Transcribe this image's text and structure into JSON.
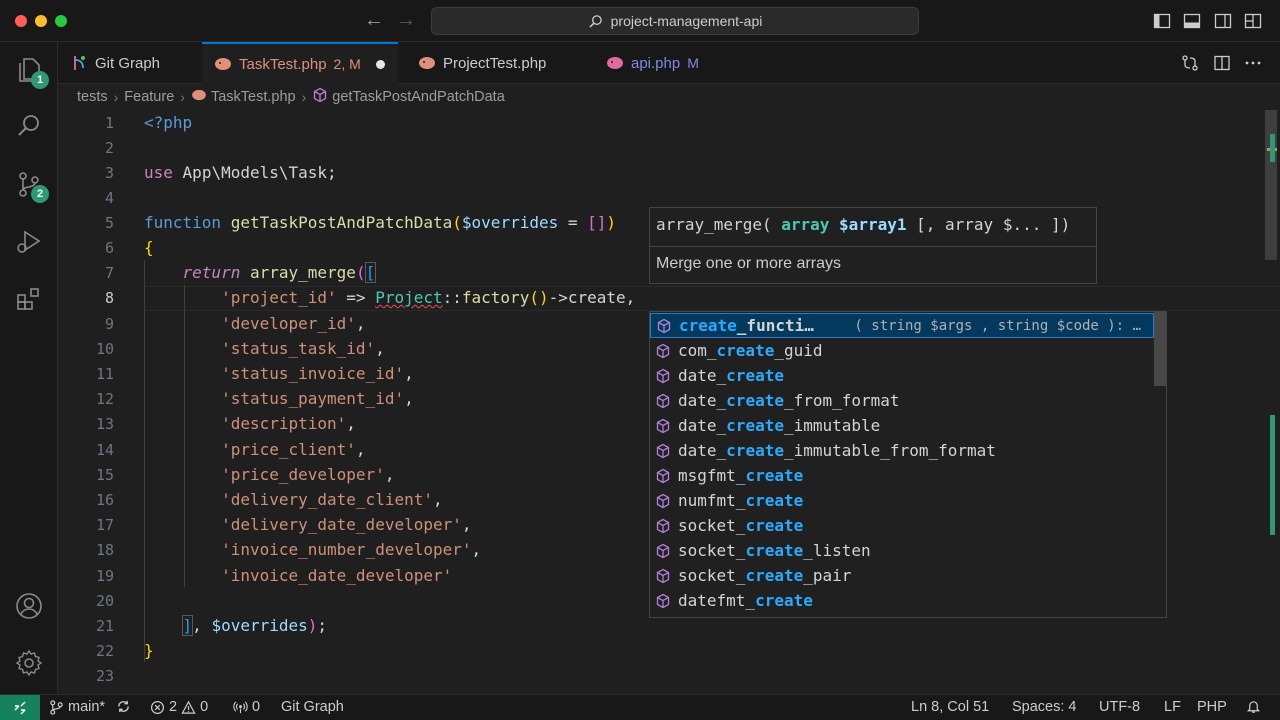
{
  "titlebar": {
    "title": "project-management-api",
    "nav_back": "←",
    "nav_forward": "→"
  },
  "activity": {
    "explorer_badge": "1",
    "scm_badge": "2"
  },
  "tabs": [
    {
      "label": "Git Graph",
      "status": ""
    },
    {
      "label": "TaskTest.php",
      "status": "2, M",
      "active": true,
      "dirty": true
    },
    {
      "label": "ProjectTest.php",
      "status": ""
    },
    {
      "label": "api.php",
      "status": "M"
    }
  ],
  "breadcrumb": {
    "items": [
      "tests",
      "Feature",
      "TaskTest.php",
      "getTaskPostAndPatchData"
    ],
    "separator": "›"
  },
  "editor": {
    "current_line": 8,
    "line_numbers": [
      "1",
      "2",
      "3",
      "4",
      "5",
      "6",
      "7",
      "8",
      "9",
      "10",
      "11",
      "12",
      "13",
      "14",
      "15",
      "16",
      "17",
      "18",
      "19",
      "20",
      "21",
      "22",
      "23"
    ],
    "code": {
      "l1": "<?php",
      "l3_use": "use",
      "l3_ns": "App\\Models\\Task",
      "l3_semi": ";",
      "l5_kw": "function",
      "l5_fn": "getTaskPostAndPatchData",
      "l5_open": "(",
      "l5_var": "$overrides",
      "l5_eq": " = ",
      "l5_arr": "[]",
      "l5_close": ")",
      "l6": "{",
      "l7_ret": "return",
      "l7_fn": "array_merge",
      "l7_open": "(",
      "l7_br": "[",
      "l8_str": "'project_id'",
      "l8_arrow": " => ",
      "l8_cls": "Project",
      "l8_sep": "::",
      "l8_fn": "factory",
      "l8_paren": "()",
      "l8_arrow2": "->",
      "l8_create": "create",
      "l8_comma": ",",
      "l9": "'developer_id'",
      "l10": "'status_task_id'",
      "l11": "'status_invoice_id'",
      "l12": "'status_payment_id'",
      "l13": "'description'",
      "l14": "'price_client'",
      "l15": "'price_developer'",
      "l16": "'delivery_date_client'",
      "l17": "'delivery_date_developer'",
      "l18": "'invoice_number_developer'",
      "l19": "'invoice_date_developer'",
      "comma": ",",
      "l21_br": "]",
      "l21_comma": ", ",
      "l21_var": "$overrides",
      "l21_close": ")",
      "l21_semi": ";",
      "l22": "}"
    }
  },
  "signature_help": {
    "fn": "array_merge( ",
    "p1_type": "array",
    "p1_var": "$array1",
    "rest": " [, array $... ])",
    "doc": "Merge one or more arrays"
  },
  "suggestions": [
    {
      "pre": "",
      "match": "create",
      "post": "_functi…",
      "detail": "( string $args , string $code ): …"
    },
    {
      "pre": "com_",
      "match": "create",
      "post": "_guid",
      "detail": ""
    },
    {
      "pre": "date_",
      "match": "create",
      "post": "",
      "detail": ""
    },
    {
      "pre": "date_",
      "match": "create",
      "post": "_from_format",
      "detail": ""
    },
    {
      "pre": "date_",
      "match": "create",
      "post": "_immutable",
      "detail": ""
    },
    {
      "pre": "date_",
      "match": "create",
      "post": "_immutable_from_format",
      "detail": ""
    },
    {
      "pre": "msgfmt_",
      "match": "create",
      "post": "",
      "detail": ""
    },
    {
      "pre": "numfmt_",
      "match": "create",
      "post": "",
      "detail": ""
    },
    {
      "pre": "socket_",
      "match": "create",
      "post": "",
      "detail": ""
    },
    {
      "pre": "socket_",
      "match": "create",
      "post": "_listen",
      "detail": ""
    },
    {
      "pre": "socket_",
      "match": "create",
      "post": "_pair",
      "detail": ""
    },
    {
      "pre": "datefmt_",
      "match": "create",
      "post": "",
      "detail": ""
    }
  ],
  "statusbar": {
    "branch": "main*",
    "errors": "2",
    "warnings": "0",
    "ports": "0",
    "git_graph": "Git Graph",
    "cursor": "Ln 8, Col 51",
    "spaces": "Spaces: 4",
    "encoding": "UTF-8",
    "eol": "LF",
    "language": "PHP"
  },
  "colors": {
    "accent": "#0078d4",
    "badge": "#2d9a72",
    "remote": "#16825d",
    "match_highlight": "#2aaaff"
  }
}
